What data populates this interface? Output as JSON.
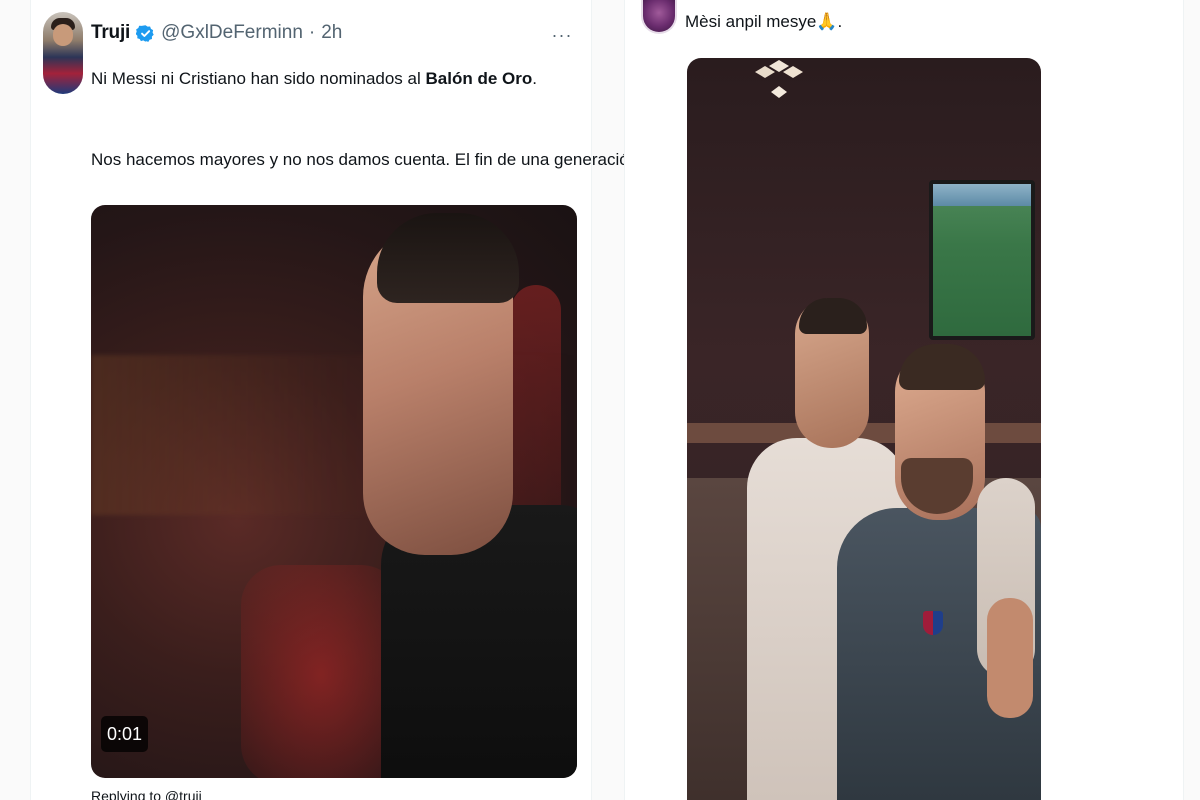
{
  "left_tweet": {
    "author_name": "Truji",
    "handle": "@GxlDeFerminn",
    "separator": "·",
    "time": "2h",
    "more_label": "···",
    "text_line1_prefix": "Ni Messi ni Cristiano han sido nominados al ",
    "text_line1_bold": "Balón de Oro",
    "text_line1_suffix": ".",
    "text_line2": "Nos hacemos mayores y no nos damos cuenta. El fin de una generación.",
    "video_duration": "0:01",
    "cut_off_text": "Replying to @truji_"
  },
  "right_tweet": {
    "text": "Mèsi anpil mesye🙏."
  },
  "colors": {
    "verified_badge": "#1d9bf0",
    "secondary_text": "#536471",
    "primary_text": "#0f1419"
  },
  "icons": {
    "verified": "verified-badge-icon",
    "more": "more-options-icon"
  }
}
